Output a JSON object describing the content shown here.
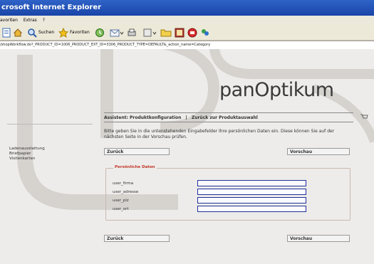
{
  "browser": {
    "title": "crosoft Internet Explorer",
    "menu": [
      "avoriten",
      "Extras",
      "?"
    ],
    "toolbar": {
      "search_label": "Suchen",
      "favorites_label": "Favoriten"
    },
    "address": "/shopWorkflow.do?_PRODUCT_ID=1006_PRODUCT_EXT_ID=3306_PRODUCT_TYPE=DEFAULT&_action_name=Category"
  },
  "page": {
    "logo": "panOptikum",
    "breadcrumb": {
      "current": "Assistent: Produktkonfiguration",
      "separator": "|",
      "back_link": "Zurück zur Produktauswahl"
    },
    "info_text": "Bitte geben Sie in die untenstehenden Eingabefelder Ihre persönlichen Daten ein. Diese können Sie auf der nächsten Seite in der Vorschau prüfen.",
    "sidebar": {
      "heading": "Ladenausstattung",
      "items": [
        "Briefpapier",
        "Visitenkarten"
      ]
    },
    "buttons": {
      "back_top": "Zurück",
      "preview_top": "Vorschau",
      "back_bottom": "Zurück",
      "preview_bottom": "Vorschau"
    },
    "form": {
      "legend": "Persönliche Daten",
      "fields": [
        {
          "label": "user_firma",
          "value": ""
        },
        {
          "label": "user_adresse",
          "value": ""
        },
        {
          "label": "user_plz",
          "value": ""
        },
        {
          "label": "user_ort",
          "value": ""
        }
      ]
    }
  },
  "colors": {
    "titlebar": "#2454b8",
    "legend": "#c0392b",
    "input_border": "#1e2f9a"
  }
}
